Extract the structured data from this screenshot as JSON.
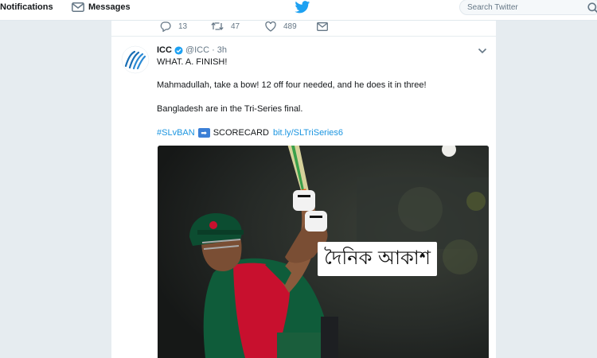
{
  "nav": {
    "notifications_label": "Notifications",
    "messages_label": "Messages",
    "search_placeholder": "Search Twitter"
  },
  "actions": {
    "reply_count": "13",
    "retweet_count": "47",
    "like_count": "489"
  },
  "tweet": {
    "author_name": "ICC",
    "author_handle": "@ICC",
    "separator": "·",
    "time": "3h",
    "line1": "WHAT. A. FINISH!",
    "line2": "Mahmadullah, take a bow! 12 off four needed, and he does it in three!",
    "line3": "Bangladesh are in the Tri-Series final.",
    "hashtag": "#SLvBAN",
    "arrow_emoji": "➡",
    "scorecard_label": "SCORECARD",
    "link": "bit.ly/SLTriSeries6"
  },
  "media": {
    "watermark_logo_text": "দৈনিক আকাশ"
  },
  "colors": {
    "twitter_blue": "#1da1f2",
    "link_blue": "#1b95e0",
    "background": "#e6ecf0",
    "jersey_green": "#0f5c3a",
    "jersey_red": "#c8102e"
  },
  "icons": [
    "bell-icon",
    "envelope-icon",
    "twitter-bird-icon",
    "search-icon",
    "reply-icon",
    "retweet-icon",
    "heart-icon",
    "direct-message-icon",
    "verified-badge-icon",
    "caret-down-icon",
    "icc-logo"
  ]
}
